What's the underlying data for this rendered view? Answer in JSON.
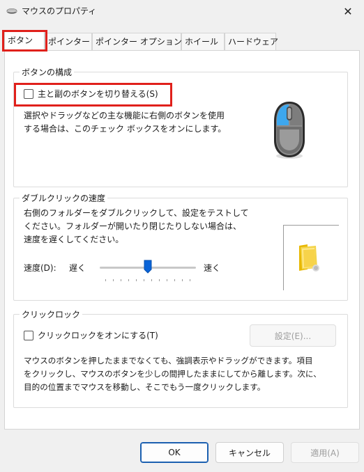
{
  "window": {
    "title": "マウスのプロパティ",
    "close_glyph": "✕",
    "app_icon": "mouse-app-icon"
  },
  "tabs": [
    {
      "label": "ボタン",
      "active": true
    },
    {
      "label": "ポインター",
      "active": false
    },
    {
      "label": "ポインター オプション",
      "active": false
    },
    {
      "label": "ホイール",
      "active": false
    },
    {
      "label": "ハードウェア",
      "active": false
    }
  ],
  "button_config": {
    "group_title": "ボタンの構成",
    "swap_checkbox_label": "主と副のボタンを切り替える(S)",
    "swap_checked": false,
    "description_lines": [
      "選択やドラッグなどの主な機能に右側のボタンを使用",
      "する場合は、このチェック ボックスをオンにします。"
    ],
    "illustration_icon": "mouse-illustration-icon"
  },
  "double_click": {
    "group_title": "ダブルクリックの速度",
    "description_lines": [
      "右側のフォルダーをダブルクリックして、設定をテストして",
      "ください。フォルダーが開いたり閉じたりしない場合は、",
      "速度を遅くしてください。"
    ],
    "speed_label": "速度(D):",
    "slow_label": "遅く",
    "fast_label": "速く",
    "slider_value": 0.5,
    "test_icon": "folder-icon"
  },
  "click_lock": {
    "group_title": "クリックロック",
    "checkbox_label": "クリックロックをオンにする(T)",
    "checked": false,
    "settings_button": "設定(E)...",
    "description_lines": [
      "マウスのボタンを押したままでなくても、強調表示やドラッグができます。項目",
      "をクリックし、マウスのボタンを少しの間押したままにしてから離します。次に、",
      "目的の位置までマウスを移動し、そこでもう一度クリックします。"
    ]
  },
  "footer": {
    "ok": "OK",
    "cancel": "キャンセル",
    "apply": "適用(A)"
  },
  "colors": {
    "highlight": "#e0201b",
    "accent": "#0a64d8",
    "mouse_blue": "#3da7ee"
  }
}
